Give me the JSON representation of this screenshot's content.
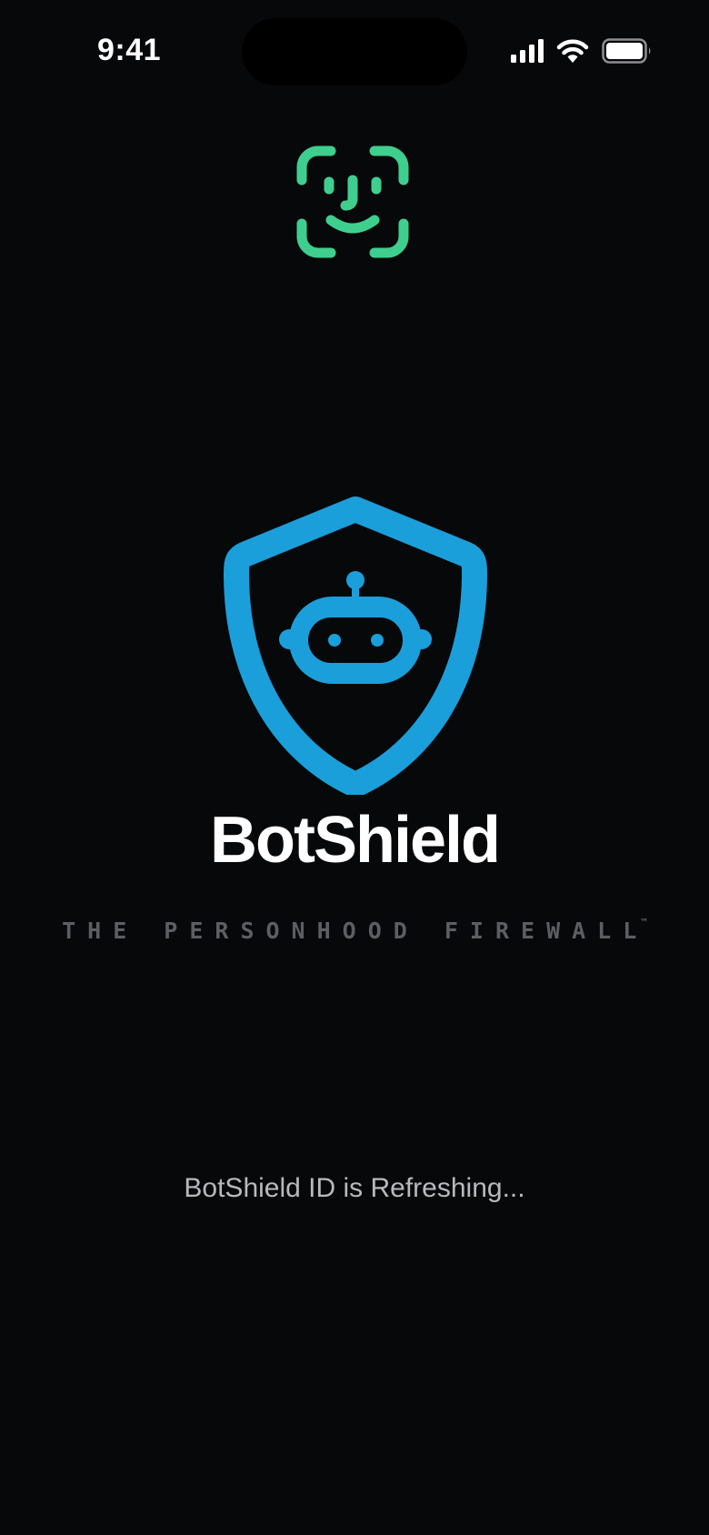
{
  "status_bar": {
    "time": "9:41",
    "icons": [
      "cellular-signal-icon",
      "wifi-icon",
      "battery-icon"
    ]
  },
  "faceid": {
    "icon": "face-id-icon",
    "color": "#3ecf8e"
  },
  "logo": {
    "icon": "shield-robot-icon",
    "color": "#1a9fda"
  },
  "brand": {
    "title": "BotShield",
    "tagline": "THE PERSONHOOD FIREWALL",
    "trademark": "™"
  },
  "status": {
    "message": "BotShield ID is Refreshing..."
  }
}
